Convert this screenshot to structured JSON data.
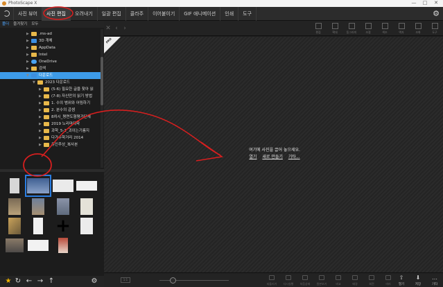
{
  "window": {
    "title": "PhotoScape X",
    "controls": [
      "—",
      "□",
      "✕"
    ]
  },
  "menu": {
    "tabs": [
      {
        "label": "사진 뷰어",
        "active": false
      },
      {
        "label": "사진 편집",
        "active": true
      },
      {
        "label": "오려내기",
        "active": false
      },
      {
        "label": "일괄 편집",
        "active": false
      },
      {
        "label": "콜라주",
        "active": false
      },
      {
        "label": "이어붙이기",
        "active": false
      },
      {
        "label": "GIF 애니메이션",
        "active": false
      },
      {
        "label": "인쇄",
        "active": false
      },
      {
        "label": "도구",
        "active": false
      }
    ],
    "settings_icon": "⚙"
  },
  "left_panel": {
    "tabs": [
      "폴더",
      "즐겨찾기",
      "모두"
    ],
    "tree": [
      {
        "label": ".ms-ad",
        "depth": 0,
        "icon": "folder",
        "expanded": false
      },
      {
        "label": "3D 개체",
        "depth": 0,
        "icon": "blue",
        "expanded": false
      },
      {
        "label": "AppData",
        "depth": 0,
        "icon": "folder",
        "expanded": false
      },
      {
        "label": "Intel",
        "depth": 0,
        "icon": "folder",
        "expanded": false
      },
      {
        "label": "OneDrive",
        "depth": 0,
        "icon": "cloud",
        "expanded": false
      },
      {
        "label": "검색",
        "depth": 0,
        "icon": "folder",
        "expanded": false
      },
      {
        "label": "다운로드",
        "depth": 0,
        "icon": "blue",
        "expanded": true,
        "selected": true
      },
      {
        "label": "2023 다운로드",
        "depth": 1,
        "icon": "folder",
        "expanded": true
      },
      {
        "label": "(5-6) 필요한 글을 찾아 읽",
        "depth": 2,
        "icon": "folder",
        "expanded": false
      },
      {
        "label": "(7-8) 자신만의 읽기 방법",
        "depth": 2,
        "icon": "folder",
        "expanded": false
      },
      {
        "label": "1. 수의 범위와 어림하기",
        "depth": 2,
        "icon": "folder",
        "expanded": false
      },
      {
        "label": "2. 분수의 곱셈",
        "depth": 2,
        "icon": "folder",
        "expanded": false
      },
      {
        "label": "8차시_평면도형평가단계",
        "depth": 2,
        "icon": "folder",
        "expanded": false
      },
      {
        "label": "2019 노리마대학",
        "depth": 2,
        "icon": "folder",
        "expanded": false
      },
      {
        "label": "과학_5-1_괴이는기름지",
        "depth": 2,
        "icon": "folder",
        "expanded": false
      },
      {
        "label": "다가수학거리 2014",
        "depth": 2,
        "icon": "folder",
        "expanded": false
      },
      {
        "label": "유인추상_복사본",
        "depth": 2,
        "icon": "folder",
        "expanded": false
      }
    ],
    "bottom_icons": [
      "★",
      "↻",
      "←",
      "→",
      "↑",
      "⚙"
    ]
  },
  "canvas": {
    "badge": "PRO",
    "drop_hint": "여기에 사진을 끌어 놓으세요.",
    "links": [
      "열기",
      "새로 만들기",
      "기타..."
    ]
  },
  "top_toolbar": {
    "tools": [
      "편집",
      "확대",
      "동그라미",
      "조절",
      "색조",
      "액자",
      "조화",
      "도구"
    ]
  },
  "bottom_toolbar": {
    "zoom_label": "1:1",
    "tools": [
      "되돌리기",
      "다시실행",
      "처음상태",
      "원본보기",
      "비교",
      "배경",
      "회전",
      "미러"
    ],
    "save_tools": [
      {
        "label": "열기",
        "icon": "⇧"
      },
      {
        "label": "저장",
        "icon": "⬇"
      },
      {
        "label": "기타",
        "icon": "…"
      }
    ]
  },
  "colors": {
    "accent": "#3d9be9",
    "annotation": "#d61f1f"
  }
}
